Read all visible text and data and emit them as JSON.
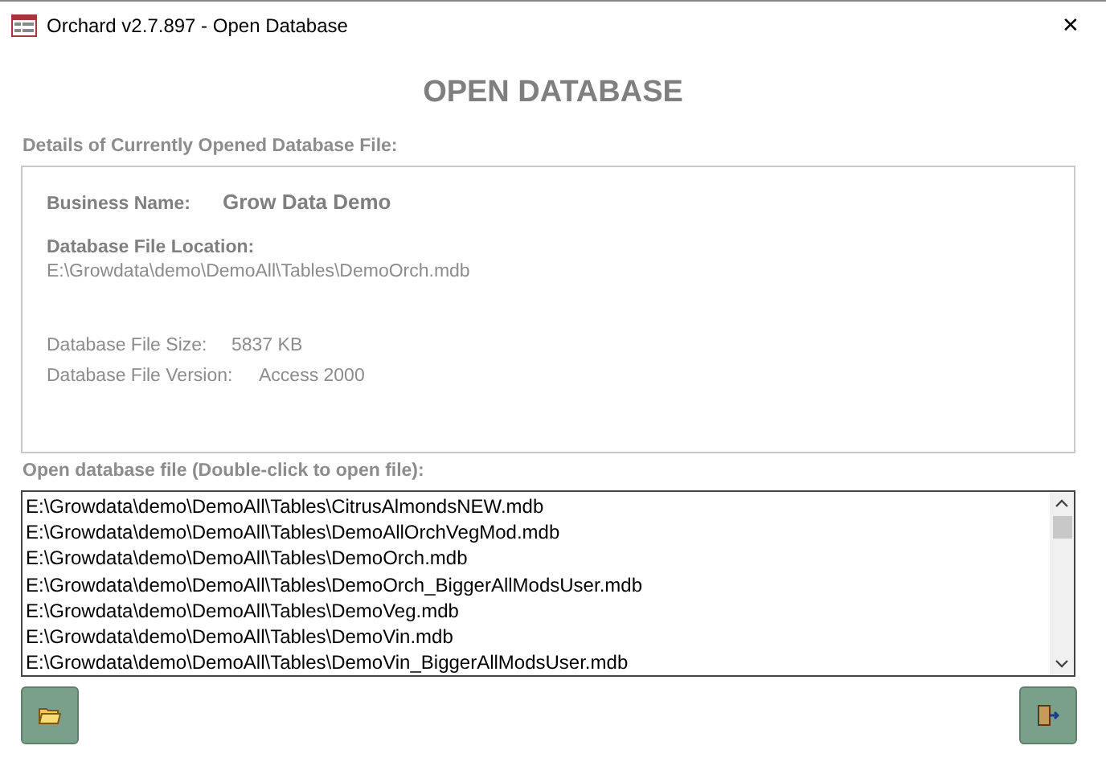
{
  "window": {
    "title": "Orchard v2.7.897 - Open Database",
    "close": "✕"
  },
  "heading": "OPEN DATABASE",
  "details": {
    "label": "Details of Currently Opened Database File:",
    "business_name_label": "Business Name:",
    "business_name": "Grow Data Demo",
    "location_label": "Database File Location:",
    "location": "E:\\Growdata\\demo\\DemoAll\\Tables\\DemoOrch.mdb",
    "size_label": "Database File Size:",
    "size": "5837 KB",
    "version_label": "Database File Version:",
    "version": "Access 2000"
  },
  "file_list": {
    "label": "Open database file (Double-click to open file):",
    "items": [
      {
        "text": "E:\\Growdata\\demo\\DemoAll\\Tables\\CitrusAlmondsNEW.mdb",
        "selected": false
      },
      {
        "text": "E:\\Growdata\\demo\\DemoAll\\Tables\\DemoAllOrchVegMod.mdb",
        "selected": false
      },
      {
        "text": "E:\\Growdata\\demo\\DemoAll\\Tables\\DemoOrch.mdb",
        "selected": false
      },
      {
        "text": "E:\\Growdata\\demo\\DemoAll\\Tables\\DemoOrch_BiggerAllModsUser.mdb",
        "selected": false
      },
      {
        "text": "E:\\Growdata\\demo\\DemoAll\\Tables\\DemoVeg.mdb",
        "selected": false
      },
      {
        "text": "E:\\Growdata\\demo\\DemoAll\\Tables\\DemoVin.mdb",
        "selected": false
      },
      {
        "text": "E:\\Growdata\\demo\\DemoAll\\Tables\\DemoVin_BiggerAllModsUser.mdb",
        "selected": false
      }
    ]
  }
}
